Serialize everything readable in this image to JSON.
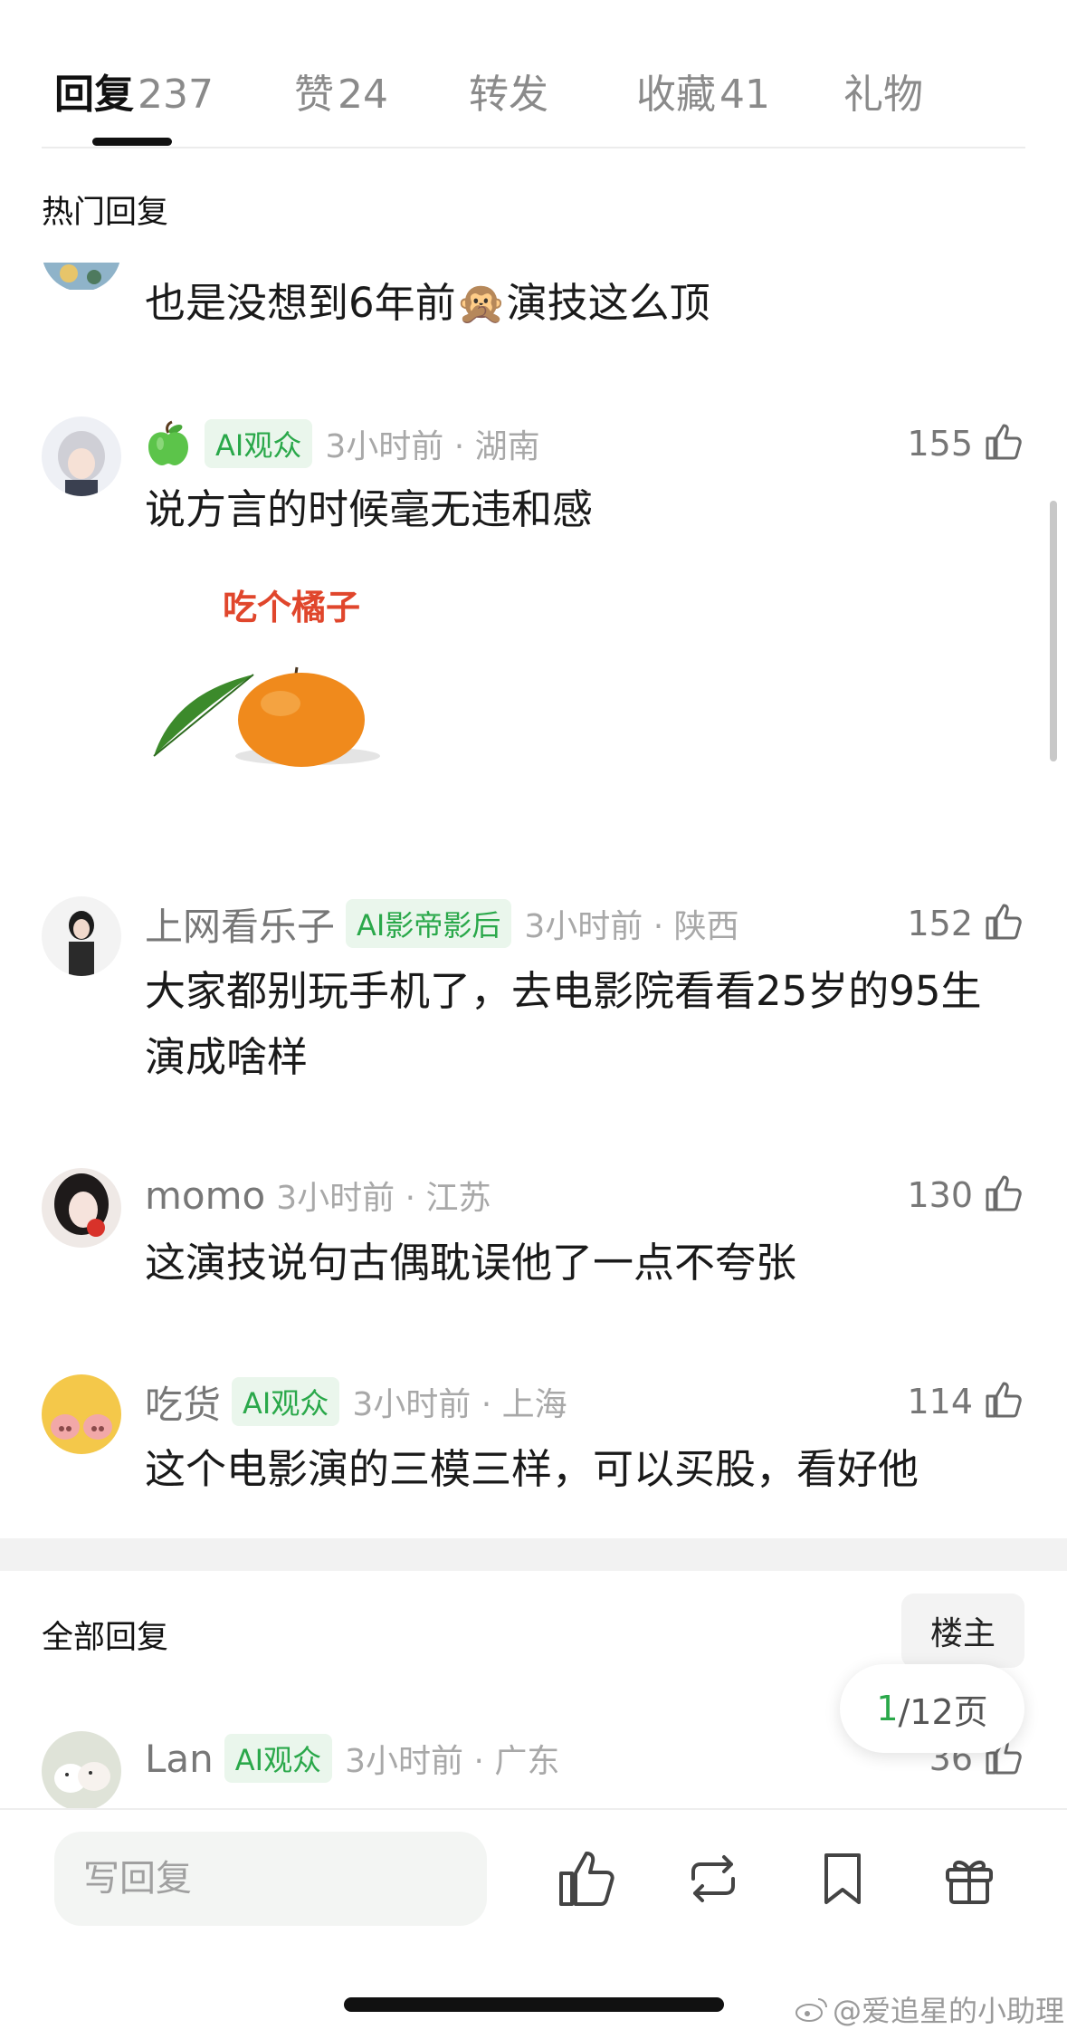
{
  "tabs": [
    {
      "label": "回复",
      "count": "237",
      "active": true
    },
    {
      "label": "赞",
      "count": "24"
    },
    {
      "label": "转发",
      "count": ""
    },
    {
      "label": "收藏",
      "count": "41"
    },
    {
      "label": "礼物",
      "count": ""
    }
  ],
  "hot_section": {
    "title": "热门回复"
  },
  "comments": [
    {
      "text": "也是没想到6年前🙊演技这么顶"
    },
    {
      "username": "",
      "badge": "AI观众",
      "time_location": "3小时前 · 湖南",
      "likes": "155",
      "text": "说方言的时候毫无违和感",
      "image_caption": "吃个橘子"
    },
    {
      "username": "上网看乐子",
      "badge": "AI影帝影后",
      "time_location": "3小时前 · 陕西",
      "likes": "152",
      "text": "大家都别玩手机了，去电影院看看25岁的95生演成啥样"
    },
    {
      "username": "momo",
      "badge": "",
      "time_location": "3小时前 · 江苏",
      "likes": "130",
      "text": "这演技说句古偶耽误他了一点不夸张"
    },
    {
      "username": "吃货",
      "badge": "AI观众",
      "time_location": "3小时前 · 上海",
      "likes": "114",
      "text": "这个电影演的三模三样，可以买股，看好他"
    },
    {
      "username": "Lan",
      "badge": "AI观众",
      "time_location": "3小时前 · 广东",
      "likes": "36",
      "text": ""
    }
  ],
  "all_section": {
    "title": "全部回复",
    "owner_button": "楼主"
  },
  "pagination": {
    "current": "1",
    "total_text": "/12页"
  },
  "bottom_bar": {
    "reply_placeholder": "写回复"
  },
  "watermark": "@爱追星的小助理",
  "icons": [
    "like-icon",
    "repost-icon",
    "bookmark-icon",
    "gift-icon",
    "apple-emoji-icon",
    "monkey-emoji-icon",
    "weibo-logo-icon"
  ],
  "colors": {
    "accent_green": "#2aa84a",
    "badge_bg": "#eaf6ec",
    "text_primary": "#1a1a1a",
    "text_secondary": "#a8a8a8"
  }
}
